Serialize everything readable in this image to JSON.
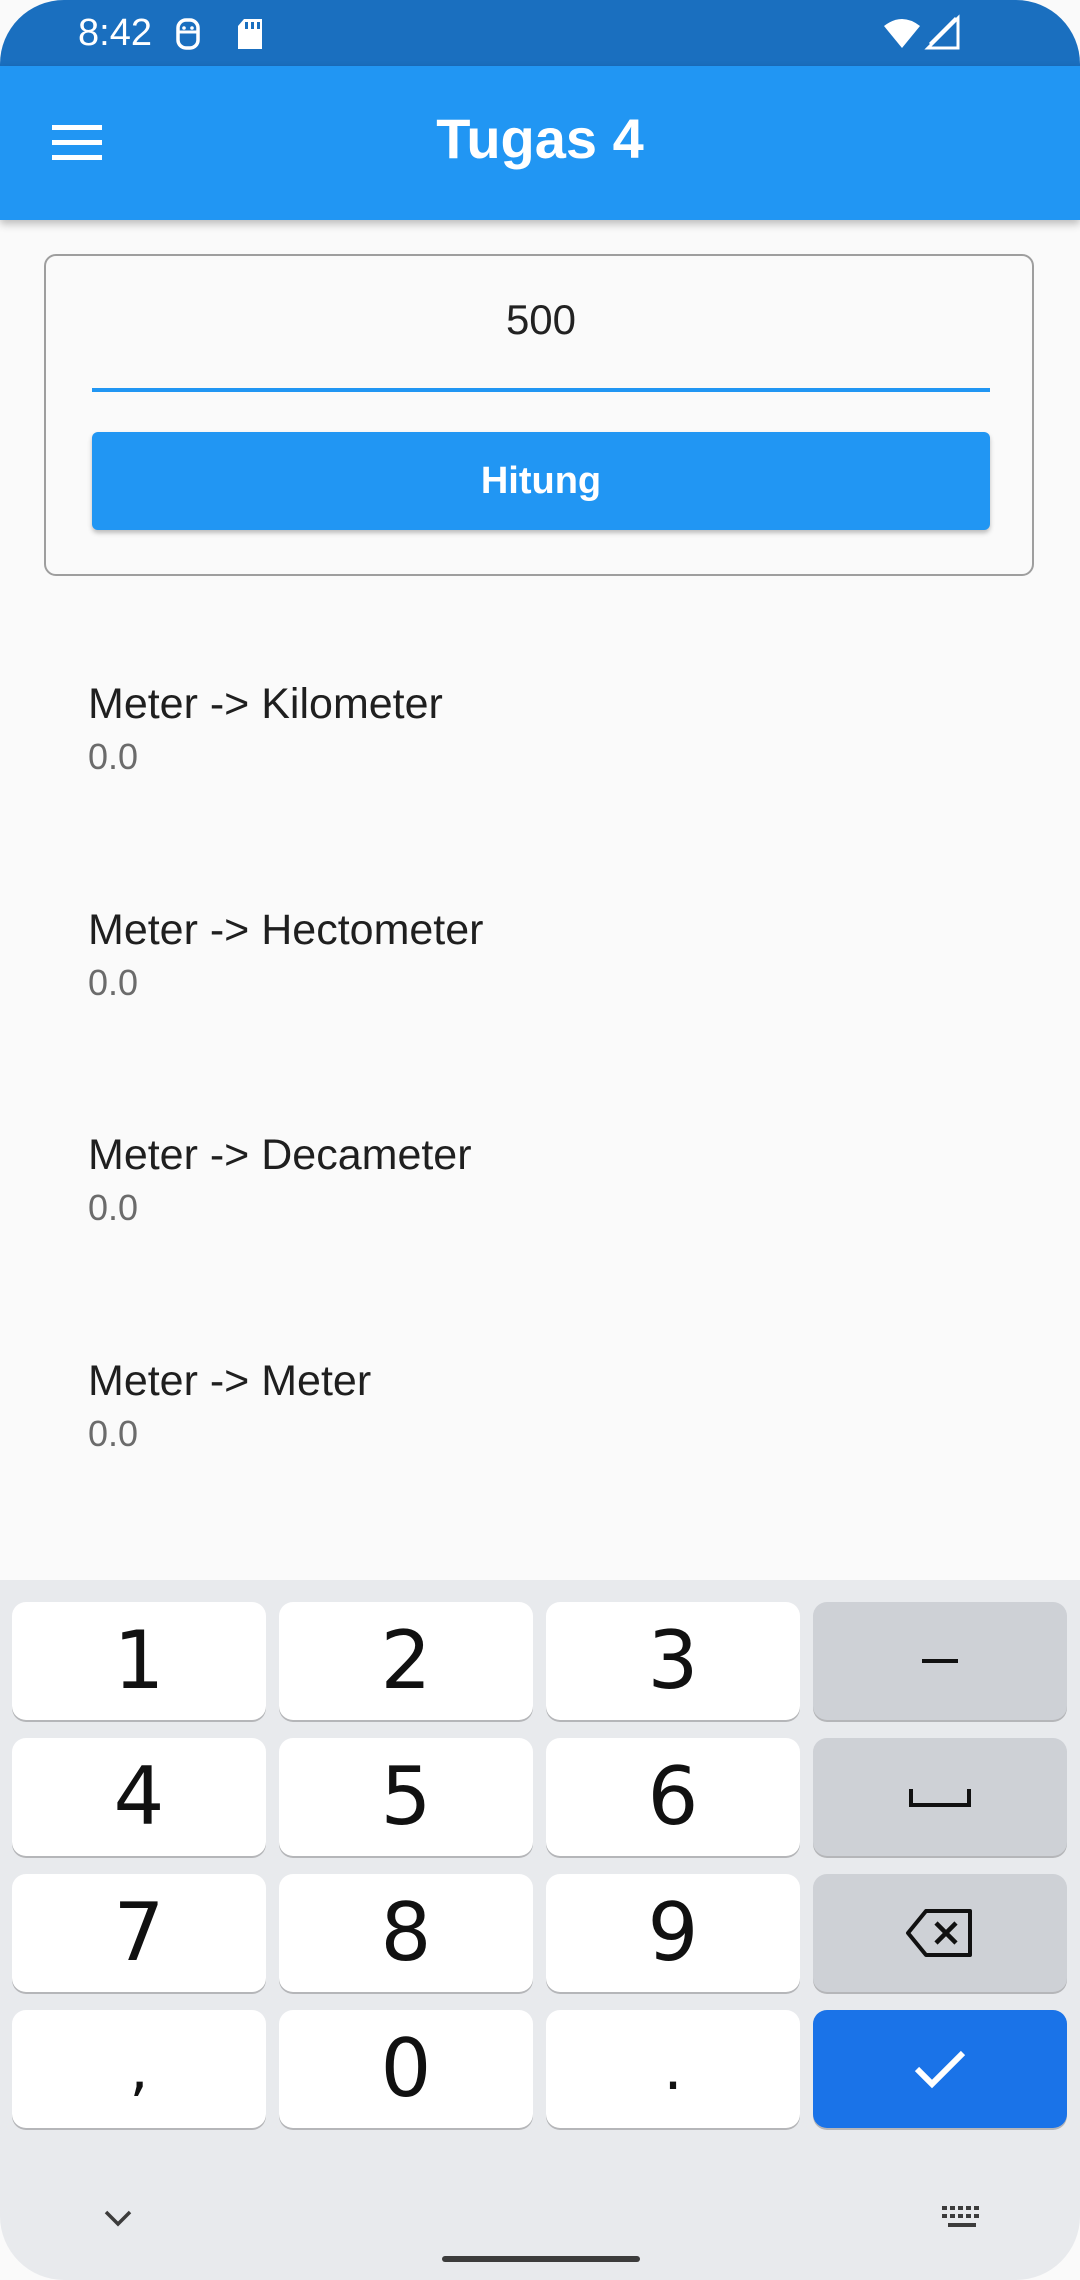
{
  "status_bar": {
    "time": "8:42",
    "icons": [
      "face-icon",
      "sd-card-icon",
      "wifi-icon",
      "no-signal-icon"
    ]
  },
  "app_bar": {
    "title": "Tugas 4",
    "menu_icon": "menu-icon"
  },
  "form": {
    "input_value": "500",
    "button_label": "Hitung"
  },
  "results": [
    {
      "label": "Meter -> Kilometer",
      "value": "0.0"
    },
    {
      "label": "Meter -> Hectometer",
      "value": "0.0"
    },
    {
      "label": "Meter -> Decameter",
      "value": "0.0"
    },
    {
      "label": "Meter -> Meter",
      "value": "0.0"
    }
  ],
  "keyboard": {
    "keys": [
      "1",
      "2",
      "3",
      "–",
      "4",
      "5",
      "6",
      "␣",
      "7",
      "8",
      "9",
      "⌫",
      ",",
      "0",
      ".",
      "✓"
    ],
    "special_icons": [
      "minus-icon",
      "space-icon",
      "backspace-icon",
      "check-icon",
      "chevron-down-icon",
      "keyboard-icon"
    ],
    "accent_color": "#1a73e8"
  },
  "colors": {
    "primary": "#2196f3",
    "status_bar": "#1a6fbf"
  }
}
